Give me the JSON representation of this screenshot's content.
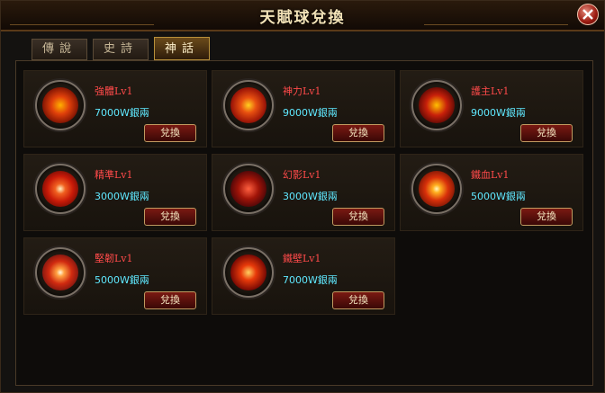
{
  "window": {
    "title": "天賦球兌換"
  },
  "tabs": [
    {
      "label": "傳說",
      "active": false
    },
    {
      "label": "史詩",
      "active": false
    },
    {
      "label": "神話",
      "active": true
    }
  ],
  "items": [
    {
      "name": "強體Lv1",
      "price": "7000W銀兩",
      "button": "兌換",
      "icon": "fire-swirl-orb-icon",
      "color": "#e0400a"
    },
    {
      "name": "神力Lv1",
      "price": "9000W銀兩",
      "button": "兌換",
      "icon": "burst-orb-icon",
      "color": "#d8380a"
    },
    {
      "name": "護主Lv1",
      "price": "9000W銀兩",
      "button": "兌換",
      "icon": "demon-face-orb-icon",
      "color": "#c8200a"
    },
    {
      "name": "精準Lv1",
      "price": "3000W銀兩",
      "button": "兌換",
      "icon": "eye-orb-icon",
      "color": "#c81a08"
    },
    {
      "name": "幻影Lv1",
      "price": "3000W銀兩",
      "button": "兌換",
      "icon": "phantom-orb-icon",
      "color": "#a01408"
    },
    {
      "name": "鐵血Lv1",
      "price": "5000W銀兩",
      "button": "兌換",
      "icon": "star-burst-orb-icon",
      "color": "#d8300a"
    },
    {
      "name": "堅韌Lv1",
      "price": "5000W銀兩",
      "button": "兌換",
      "icon": "light-burst-orb-icon",
      "color": "#d02a10"
    },
    {
      "name": "鐵壁Lv1",
      "price": "7000W銀兩",
      "button": "兌換",
      "icon": "shield-burst-orb-icon",
      "color": "#c8200a"
    }
  ]
}
